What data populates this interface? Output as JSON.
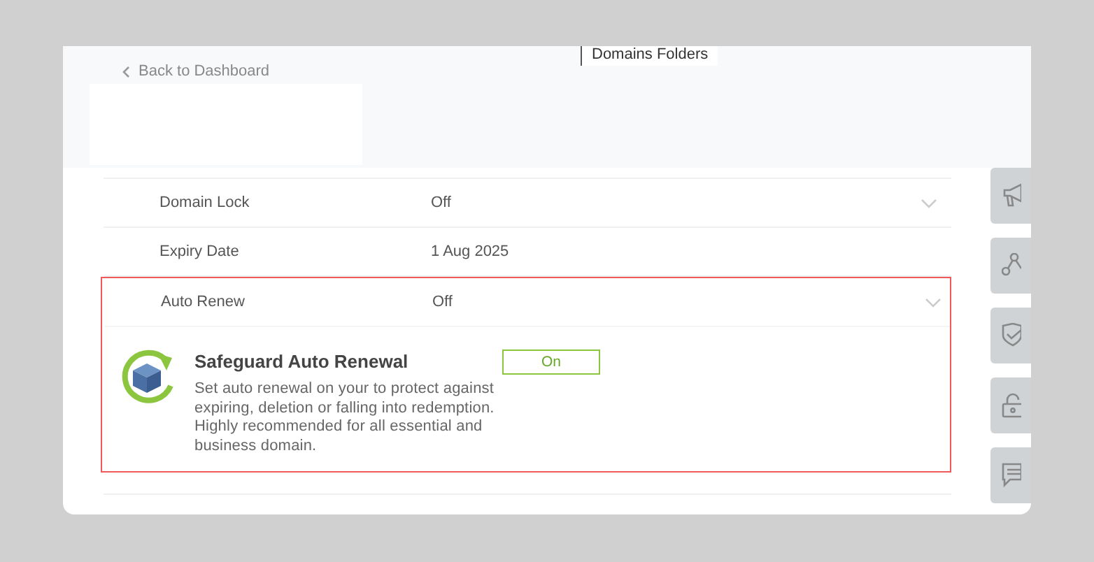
{
  "header": {
    "back_link": "Back to Dashboard",
    "folders_tab": "Domains Folders"
  },
  "settings": [
    {
      "label": "Domain Lock",
      "value": "Off",
      "expandable": true
    },
    {
      "label": "Expiry Date",
      "value": "1 Aug 2025",
      "expandable": false
    }
  ],
  "auto_renew": {
    "label": "Auto Renew",
    "value": "Off",
    "expandable": true,
    "promo": {
      "title": "Safeguard Auto Renewal",
      "description": "Set auto renewal on your to protect against expiring, deletion or falling into redemption. Highly recommended for all essential and business domain.",
      "toggle": {
        "label": "On",
        "on": true
      }
    }
  }
}
